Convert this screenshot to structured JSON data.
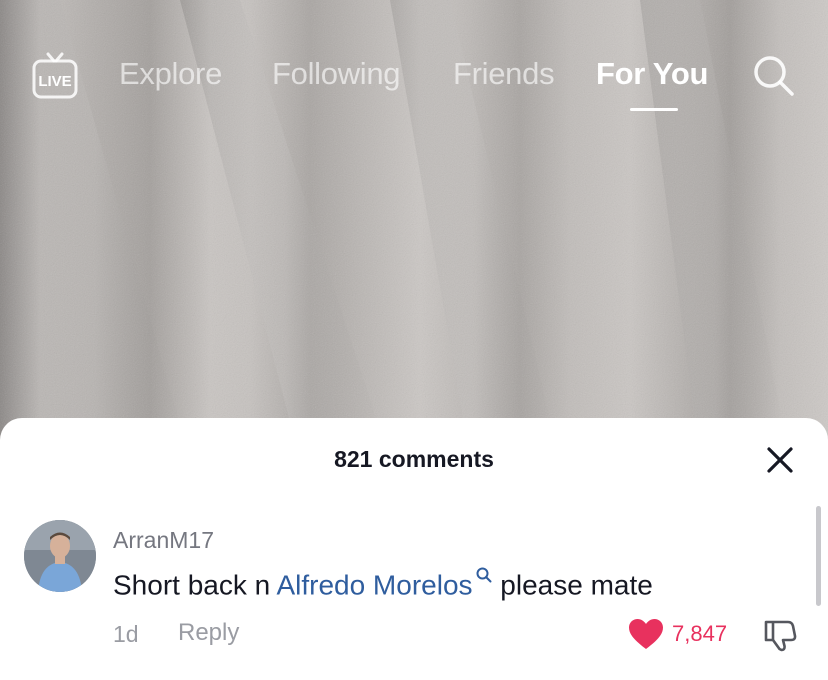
{
  "nav": {
    "live_label": "LIVE",
    "tabs": [
      {
        "label": "Explore"
      },
      {
        "label": "Following"
      },
      {
        "label": "Friends"
      },
      {
        "label": "For You",
        "active": true
      }
    ]
  },
  "comments_sheet": {
    "title": "821 comments",
    "comment": {
      "username": "ArranM17",
      "text_before": "Short back n ",
      "mention": "Alfredo Morelos",
      "text_after": " please mate",
      "time": "1d",
      "reply_label": "Reply",
      "like_count": "7,847"
    }
  },
  "colors": {
    "like": "#e8315e",
    "mention": "#2f5d9e",
    "text_primary": "#161823",
    "text_secondary": "#9a9ca3"
  },
  "icons": [
    "live-icon",
    "search-icon",
    "close-icon",
    "heart-icon",
    "dislike-icon",
    "mention-search-icon"
  ]
}
